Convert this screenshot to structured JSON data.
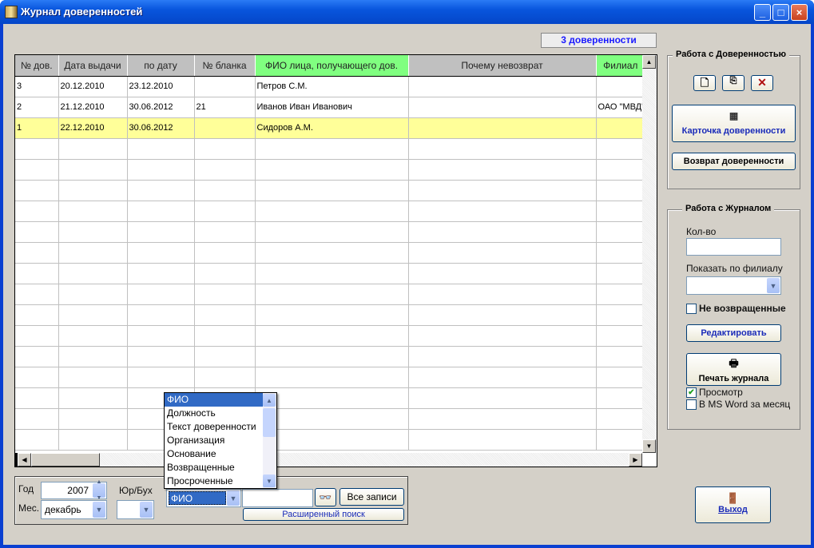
{
  "window": {
    "title": "Журнал доверенностей",
    "minimize": "_",
    "maximize": "□",
    "close": "×"
  },
  "count_label": "3 доверенности",
  "grid": {
    "columns": [
      "№ дов.",
      "Дата выдачи",
      "по дату",
      "№ бланка",
      "ФИО лица, получающего дов.",
      "Почему невозврат",
      "Филиал"
    ],
    "rows": [
      [
        "3",
        "20.12.2010",
        "23.12.2010",
        "",
        "Петров С.М.",
        "",
        ""
      ],
      [
        "2",
        "21.12.2010",
        "30.06.2012",
        "21",
        "Иванов Иван Иванович",
        "",
        "ОАО \"МВД\""
      ],
      [
        "1",
        "22.12.2010",
        "30.06.2012",
        "",
        "Сидоров А.М.",
        "",
        ""
      ]
    ],
    "selected_row": 2
  },
  "proxy_group": {
    "title": "Работа с Доверенностью",
    "card_button": "Карточка доверенности",
    "return_button": "Возврат доверенности"
  },
  "journal_group": {
    "title": "Работа с Журналом",
    "qty_label": "Кол-во",
    "qty_value": "",
    "branch_label": "Показать по филиалу",
    "branch_value": "",
    "not_returned": "Не возвращенные",
    "not_returned_checked": false,
    "edit_button": "Редактировать",
    "print_button": "Печать журнала",
    "preview": "Просмотр",
    "preview_checked": true,
    "word": "В MS Word за месяц",
    "word_checked": false
  },
  "filter": {
    "year_label": "Год",
    "year": "2007",
    "month_label": "Мес.",
    "month": "декабрь",
    "type_label": "Юр/Бух",
    "type_value": "",
    "field_value": "ФИО",
    "search_value": "",
    "all_button": "Все записи",
    "advanced_button": "Расширенный поиск",
    "field_options": [
      "ФИО",
      "Должность",
      "Текст доверенности",
      "Организация",
      "Основание",
      "Возвращенные",
      "Просроченные"
    ]
  },
  "exit_button": "Выход",
  "colors": {
    "header_gray": "#c0c0c0",
    "header_green": "#80ff80",
    "selected_row": "#ffff99",
    "accent_blue": "#1a1aff"
  }
}
